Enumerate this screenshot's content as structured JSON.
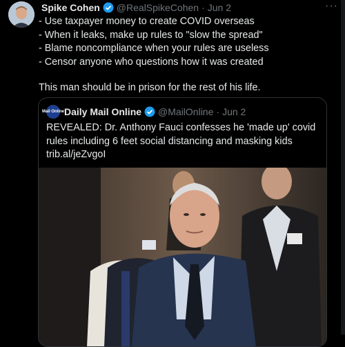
{
  "tweet": {
    "display_name": "Spike Cohen",
    "handle": "@RealSpikeCohen",
    "date": "Jun 2",
    "more_label": "···",
    "lines": [
      "- Use taxpayer money to create COVID overseas",
      "- When it leaks, make up rules to \"slow the spread\"",
      "- Blame noncompliance when your rules are useless",
      "- Censor anyone who questions how it was created",
      "",
      "This man should be in prison for the rest of his life."
    ]
  },
  "quote": {
    "logo_text": "Mail Online",
    "display_name": "Daily Mail Online",
    "handle": "@MailOnline",
    "date": "Jun 2",
    "lines": [
      "REVEALED: Dr. Anthony Fauci confesses he 'made up' covid",
      "rules including 6 feet social distancing and masking kids",
      "trib.al/jeZvgoI"
    ]
  },
  "separator": "·",
  "colors": {
    "background": "#000000",
    "text": "#e7e9ea",
    "muted": "#71767b",
    "verified": "#1d9bf0",
    "border": "#2f3336"
  },
  "icons": {
    "verified": "verified-badge-icon",
    "more": "more-icon"
  }
}
